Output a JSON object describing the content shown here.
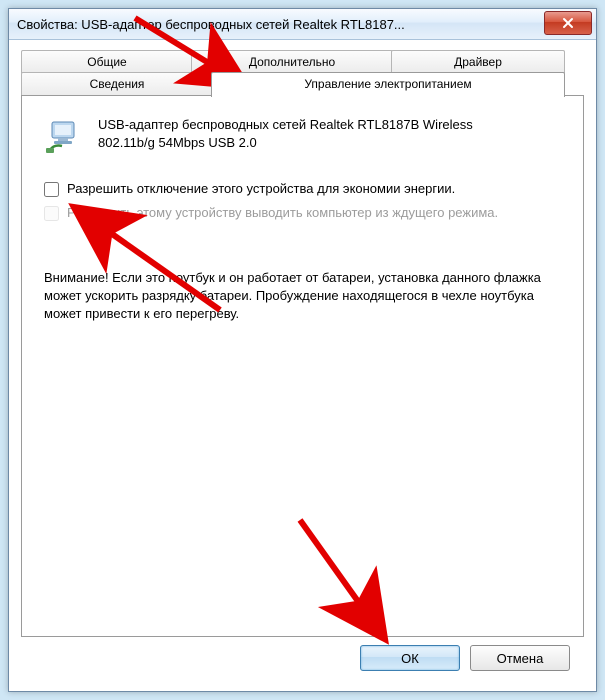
{
  "window": {
    "title": "Свойства: USB-адаптер беспроводных сетей Realtek RTL8187..."
  },
  "tabs": {
    "general": "Общие",
    "advanced": "Дополнительно",
    "driver": "Драйвер",
    "details": "Сведения",
    "power": "Управление электропитанием"
  },
  "device": {
    "name_line1": "USB-адаптер беспроводных сетей Realtek RTL8187B Wireless",
    "name_line2": "802.11b/g 54Mbps USB 2.0"
  },
  "options": {
    "allow_off": "Разрешить отключение этого устройства для экономии энергии.",
    "allow_wake": "Разрешить этому устройству выводить компьютер из ждущего режима."
  },
  "warning": "Внимание! Если это ноутбук и он работает от батареи, установка данного флажка может ускорить разрядку батареи. Пробуждение находящегося в чехле ноутбука может привести к его перегреву.",
  "buttons": {
    "ok": "ОК",
    "cancel": "Отмена"
  }
}
